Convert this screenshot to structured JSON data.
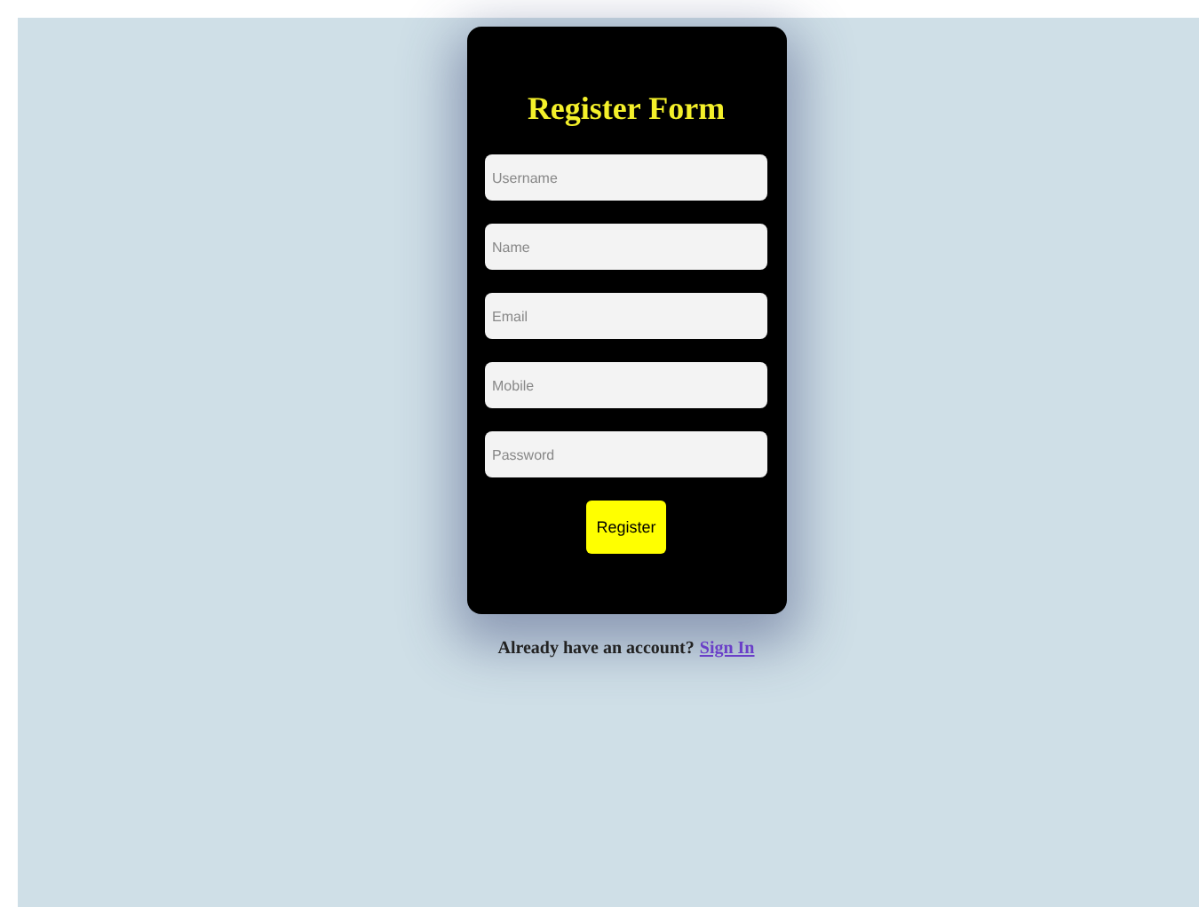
{
  "form": {
    "title": "Register Form",
    "fields": [
      {
        "placeholder": "Username"
      },
      {
        "placeholder": "Name"
      },
      {
        "placeholder": "Email"
      },
      {
        "placeholder": "Mobile"
      },
      {
        "placeholder": "Password"
      }
    ],
    "button": "Register"
  },
  "footer": {
    "text": "Already have an account?",
    "link": "Sign In"
  }
}
